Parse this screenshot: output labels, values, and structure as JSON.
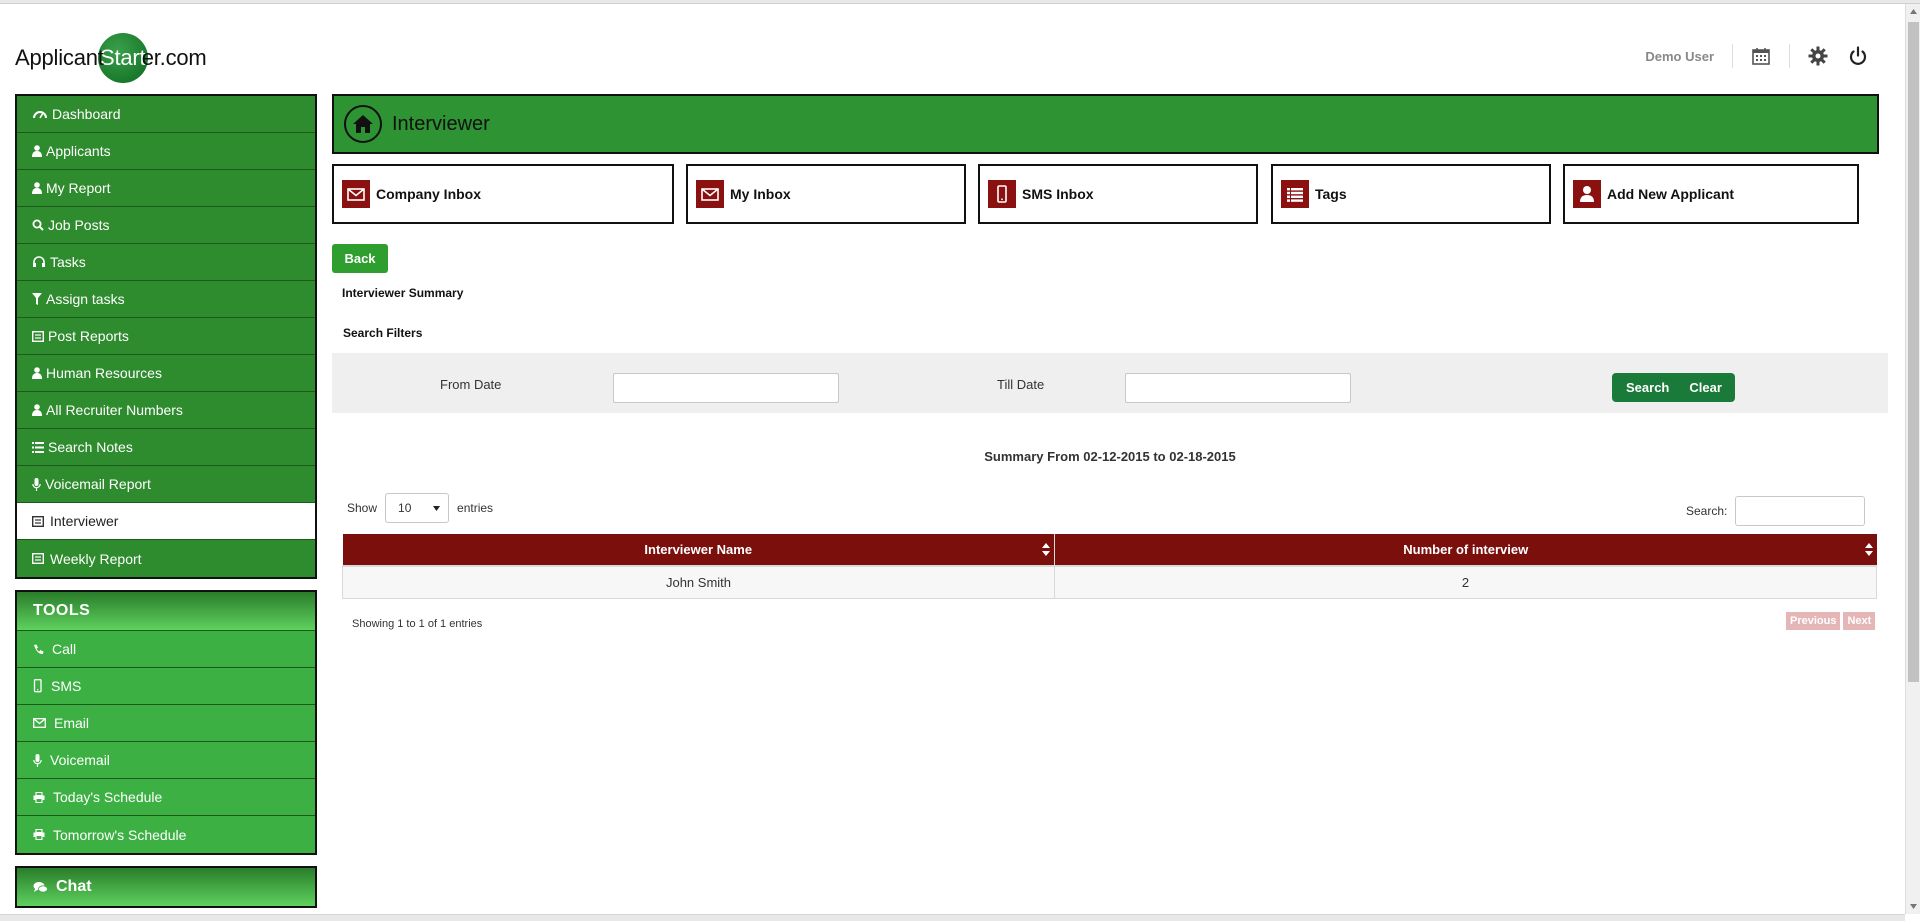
{
  "brand": {
    "logo_pre": "Applicant",
    "logo_circle": "Start",
    "logo_post": "er.com"
  },
  "topbar": {
    "user": "Demo User",
    "icons": [
      "calendar-icon",
      "gear-icon",
      "power-icon"
    ]
  },
  "sidebar": {
    "items": [
      {
        "label": "Dashboard",
        "icon": "dashboard-icon"
      },
      {
        "label": "Applicants",
        "icon": "user-icon"
      },
      {
        "label": "My Report",
        "icon": "user-icon"
      },
      {
        "label": "Job Posts",
        "icon": "search-icon"
      },
      {
        "label": "Tasks",
        "icon": "headphones-icon"
      },
      {
        "label": "Assign tasks",
        "icon": "filter-icon"
      },
      {
        "label": "Post Reports",
        "icon": "list-alt-icon"
      },
      {
        "label": "Human Resources",
        "icon": "user-icon"
      },
      {
        "label": "All Recruiter Numbers",
        "icon": "user-icon"
      },
      {
        "label": "Search Notes",
        "icon": "list-icon"
      },
      {
        "label": "Voicemail Report",
        "icon": "microphone-icon"
      },
      {
        "label": "Interviewer",
        "icon": "list-alt-icon",
        "active": true
      },
      {
        "label": "Weekly Report",
        "icon": "list-alt-icon"
      }
    ],
    "tools_title": "TOOLS",
    "tools": [
      {
        "label": "Call",
        "icon": "phone-icon"
      },
      {
        "label": "SMS",
        "icon": "mobile-icon"
      },
      {
        "label": "Email",
        "icon": "envelope-icon"
      },
      {
        "label": "Voicemail",
        "icon": "microphone-icon"
      },
      {
        "label": "Today's Schedule",
        "icon": "print-icon"
      },
      {
        "label": "Tomorrow's Schedule",
        "icon": "print-icon"
      }
    ],
    "chat_title": "Chat"
  },
  "header": {
    "title": "Interviewer",
    "icon": "home-icon"
  },
  "quick_links": [
    {
      "label": "Company Inbox",
      "icon": "envelope-icon"
    },
    {
      "label": "My Inbox",
      "icon": "envelope-icon"
    },
    {
      "label": "SMS Inbox",
      "icon": "mobile-icon"
    },
    {
      "label": "Tags",
      "icon": "list-icon"
    },
    {
      "label": "Add New Applicant",
      "icon": "user-icon"
    }
  ],
  "actions": {
    "back": "Back"
  },
  "sections": {
    "summary": "Interviewer Summary",
    "filters": "Search Filters"
  },
  "filters": {
    "from_label": "From Date",
    "from_value": "",
    "till_label": "Till Date",
    "till_value": "",
    "search_btn": "Search",
    "clear_btn": "Clear"
  },
  "summary_range": "Summary From 02-12-2015 to 02-18-2015",
  "table_controls": {
    "show_label": "Show",
    "entries_value": "10",
    "entries_label": "entries",
    "search_label": "Search:"
  },
  "table": {
    "columns": [
      "Interviewer Name",
      "Number of interview"
    ],
    "rows": [
      [
        "John Smith",
        "2"
      ]
    ]
  },
  "footer": {
    "info": "Showing 1 to 1 of 1 entries",
    "previous": "Previous",
    "next": "Next"
  },
  "colors": {
    "nav_green": "#2e8b2e",
    "tools_green": "#3cb043",
    "header_green": "#2e9332",
    "maroon": "#7a0f0c",
    "button_green": "#1a7a3a"
  }
}
